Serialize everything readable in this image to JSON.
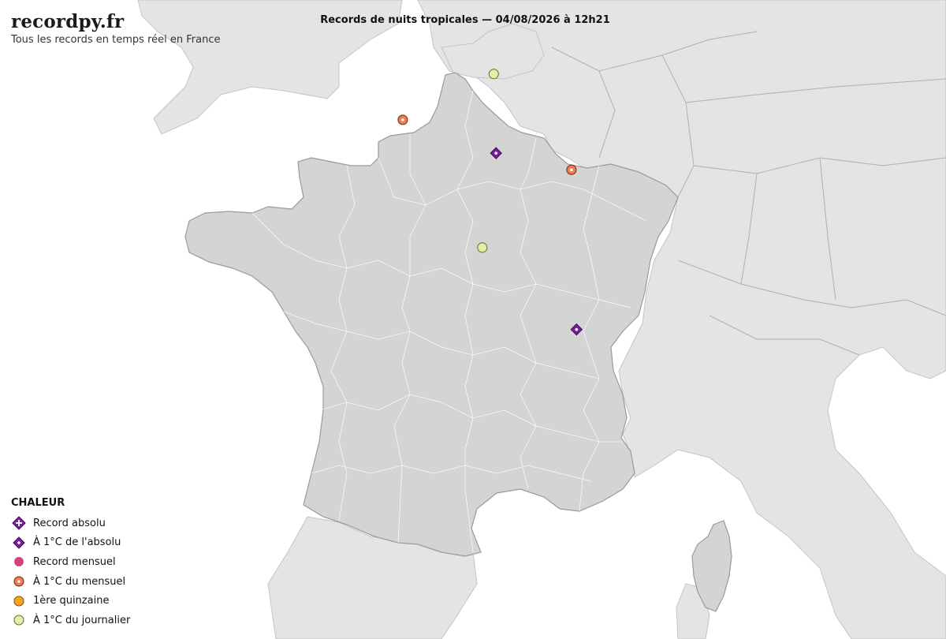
{
  "brand": {
    "title": "recordpy.fr",
    "subtitle": "Tous les records en temps réel en France"
  },
  "map_title": "Records de nuits tropicales — 04/08/2026 à 12h21",
  "colors": {
    "sea": "#ffffff",
    "land_other": "#e4e4e4",
    "france": "#d4d4d4",
    "border": "#9a9a9a",
    "dept_border": "#ffffff"
  },
  "legend": {
    "title": "CHALEUR",
    "items": [
      {
        "key": "record_absolu",
        "label": "Record absolu"
      },
      {
        "key": "proche_absolu",
        "label": "À 1°C de l'absolu"
      },
      {
        "key": "record_mensuel",
        "label": "Record mensuel"
      },
      {
        "key": "proche_mensuel",
        "label": "À 1°C du mensuel"
      },
      {
        "key": "quinzaine",
        "label": "1ère quinzaine"
      },
      {
        "key": "proche_journalier",
        "label": "À 1°C du journalier"
      }
    ]
  },
  "marker_styles": {
    "record_absolu": {
      "fill": "#7b1fa2",
      "shape": "diamond-plus"
    },
    "proche_absolu": {
      "fill": "#7b1fa2",
      "shape": "diamond-dot"
    },
    "record_mensuel": {
      "fill": "#d6427a",
      "shape": "circle"
    },
    "proche_mensuel": {
      "fill": "#ee7d52",
      "shape": "circle-dot"
    },
    "quinzaine": {
      "fill": "#f5a623",
      "shape": "circle"
    },
    "proche_journalier": {
      "fill": "#e3f0a6",
      "shape": "circle"
    }
  },
  "stations": [
    {
      "lon": 4.35,
      "lat": 46.47,
      "type": "proche_absolu"
    },
    {
      "lon": 2.59,
      "lat": 49.01,
      "type": "proche_absolu"
    },
    {
      "lon": 2.54,
      "lat": 50.15,
      "type": "proche_journalier"
    },
    {
      "lon": 0.55,
      "lat": 49.49,
      "type": "proche_mensuel"
    },
    {
      "lon": 2.29,
      "lat": 47.65,
      "type": "proche_journalier"
    },
    {
      "lon": 4.24,
      "lat": 48.77,
      "type": "proche_mensuel"
    }
  ]
}
